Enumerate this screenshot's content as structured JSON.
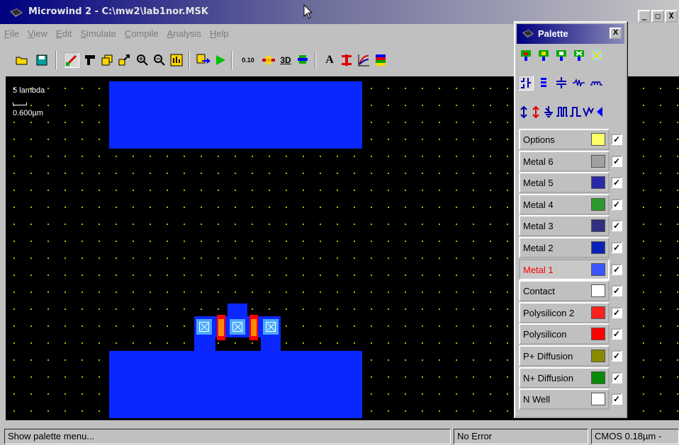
{
  "window": {
    "title": "Microwind 2 - C:\\mw2\\lab1nor.MSK",
    "btn_min": "_",
    "btn_max": "□",
    "btn_close": "X"
  },
  "menu": [
    "File",
    "View",
    "Edit",
    "Simulate",
    "Compile",
    "Analysis",
    "Help"
  ],
  "toolbar": {
    "icons": [
      "open-icon",
      "save-icon",
      "draw-box-icon",
      "cut-icon",
      "copy-icon",
      "stretch-icon",
      "zoom-in-icon",
      "zoom-out-icon",
      "view-all-icon",
      "extract-icon",
      "run-icon",
      "process-icon",
      "mos-view-icon",
      "view-3d-icon",
      "2d-view-icon",
      "text-icon",
      "vertical-cut-icon",
      "curve-icon",
      "palette-icon"
    ],
    "labels": {
      "process": "0.10",
      "view3d": "3D",
      "text": "A"
    }
  },
  "canvas": {
    "scale_label": "5 lambda",
    "scale_value": "0.600µm"
  },
  "palette": {
    "title": "Palette",
    "close": "X",
    "layers": [
      {
        "label": "Options",
        "color": "#ffff66",
        "checked": "✓"
      },
      {
        "label": "Metal 6",
        "color": "#a0a0a0",
        "checked": "✓"
      },
      {
        "label": "Metal 5",
        "color": "#2a2aa8",
        "checked": "✓"
      },
      {
        "label": "Metal 4",
        "color": "#2e9a2e",
        "checked": "✓"
      },
      {
        "label": "Metal 3",
        "color": "#303080",
        "checked": "✓"
      },
      {
        "label": "Metal 2",
        "color": "#0b22b8",
        "checked": "✓"
      },
      {
        "label": "Metal 1",
        "color": "#3b54ff",
        "checked": "✓"
      },
      {
        "label": "Contact",
        "color": "#ffffff",
        "checked": "✓"
      },
      {
        "label": "Polysilicon 2",
        "color": "#ff2020",
        "checked": "✓"
      },
      {
        "label": "Polysilicon",
        "color": "#ff0000",
        "checked": "✓"
      },
      {
        "label": "P+ Diffusion",
        "color": "#8a8a00",
        "checked": "✓"
      },
      {
        "label": "N+ Diffusion",
        "color": "#0a8a0a",
        "checked": "✓"
      },
      {
        "label": "N Well",
        "color": "#ffffff",
        "checked": "✓"
      }
    ],
    "active_layer": "Metal 1"
  },
  "status": {
    "hint": "Show palette menu...",
    "error": "No Error",
    "tech": "CMOS 0.18µm -"
  }
}
